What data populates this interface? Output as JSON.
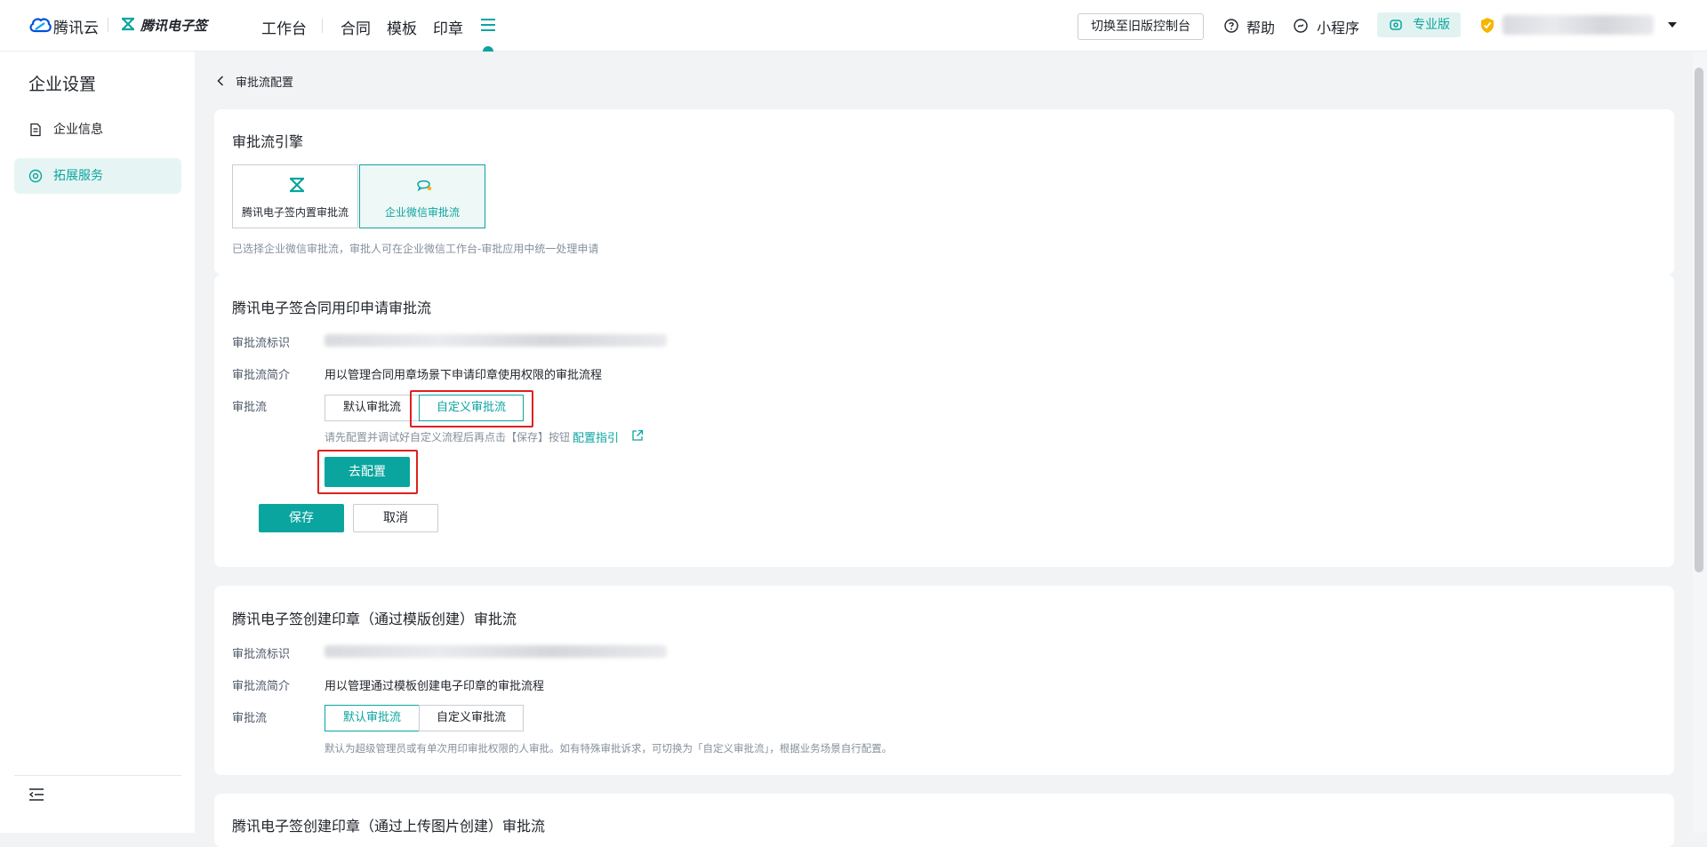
{
  "header": {
    "brand_cloud": "腾讯云",
    "brand_esign": "腾讯电子签",
    "nav": [
      "工作台",
      "合同",
      "模板",
      "印章"
    ],
    "switch_console": "切换至旧版控制台",
    "help": "帮助",
    "mini_program": "小程序",
    "edition": "专业版"
  },
  "sidebar": {
    "title": "企业设置",
    "items": [
      {
        "label": "企业信息",
        "icon": "document-icon"
      },
      {
        "label": "拓展服务",
        "icon": "extension-icon"
      }
    ],
    "active_index": 1
  },
  "breadcrumb": {
    "back_label": "审批流配置"
  },
  "engine": {
    "title": "审批流引擎",
    "options": [
      {
        "label": "腾讯电子签内置审批流",
        "icon": "esign-icon"
      },
      {
        "label": "企业微信审批流",
        "icon": "wecom-chat-icon"
      }
    ],
    "selected_index": 1,
    "hint": "已选择企业微信审批流，审批人可在企业微信工作台-审批应用中统一处理申请"
  },
  "sections": [
    {
      "title": "腾讯电子签合同用印申请审批流",
      "id_label": "审批流标识",
      "intro_label": "审批流简介",
      "intro": "用以管理合同用章场景下申请印章使用权限的审批流程",
      "flow_label": "审批流",
      "options": [
        "默认审批流",
        "自定义审批流"
      ],
      "selected_index": 1,
      "hint": "请先配置并调试好自定义流程后再点击【保存】按钮",
      "guide_link": "配置指引",
      "configure_button": "去配置",
      "save_button": "保存",
      "cancel_button": "取消"
    },
    {
      "title": "腾讯电子签创建印章（通过模版创建）审批流",
      "id_label": "审批流标识",
      "intro_label": "审批流简介",
      "intro": "用以管理通过模板创建电子印章的审批流程",
      "flow_label": "审批流",
      "options": [
        "默认审批流",
        "自定义审批流"
      ],
      "selected_index": 0,
      "hint": "默认为超级管理员或有单次用印审批权限的人审批。如有特殊审批诉求，可切换为「自定义审批流」，根据业务场景自行配置。"
    },
    {
      "title": "腾讯电子签创建印章（通过上传图片创建）审批流"
    }
  ],
  "colors": {
    "accent": "#0aa59f",
    "highlight": "#e02020"
  }
}
